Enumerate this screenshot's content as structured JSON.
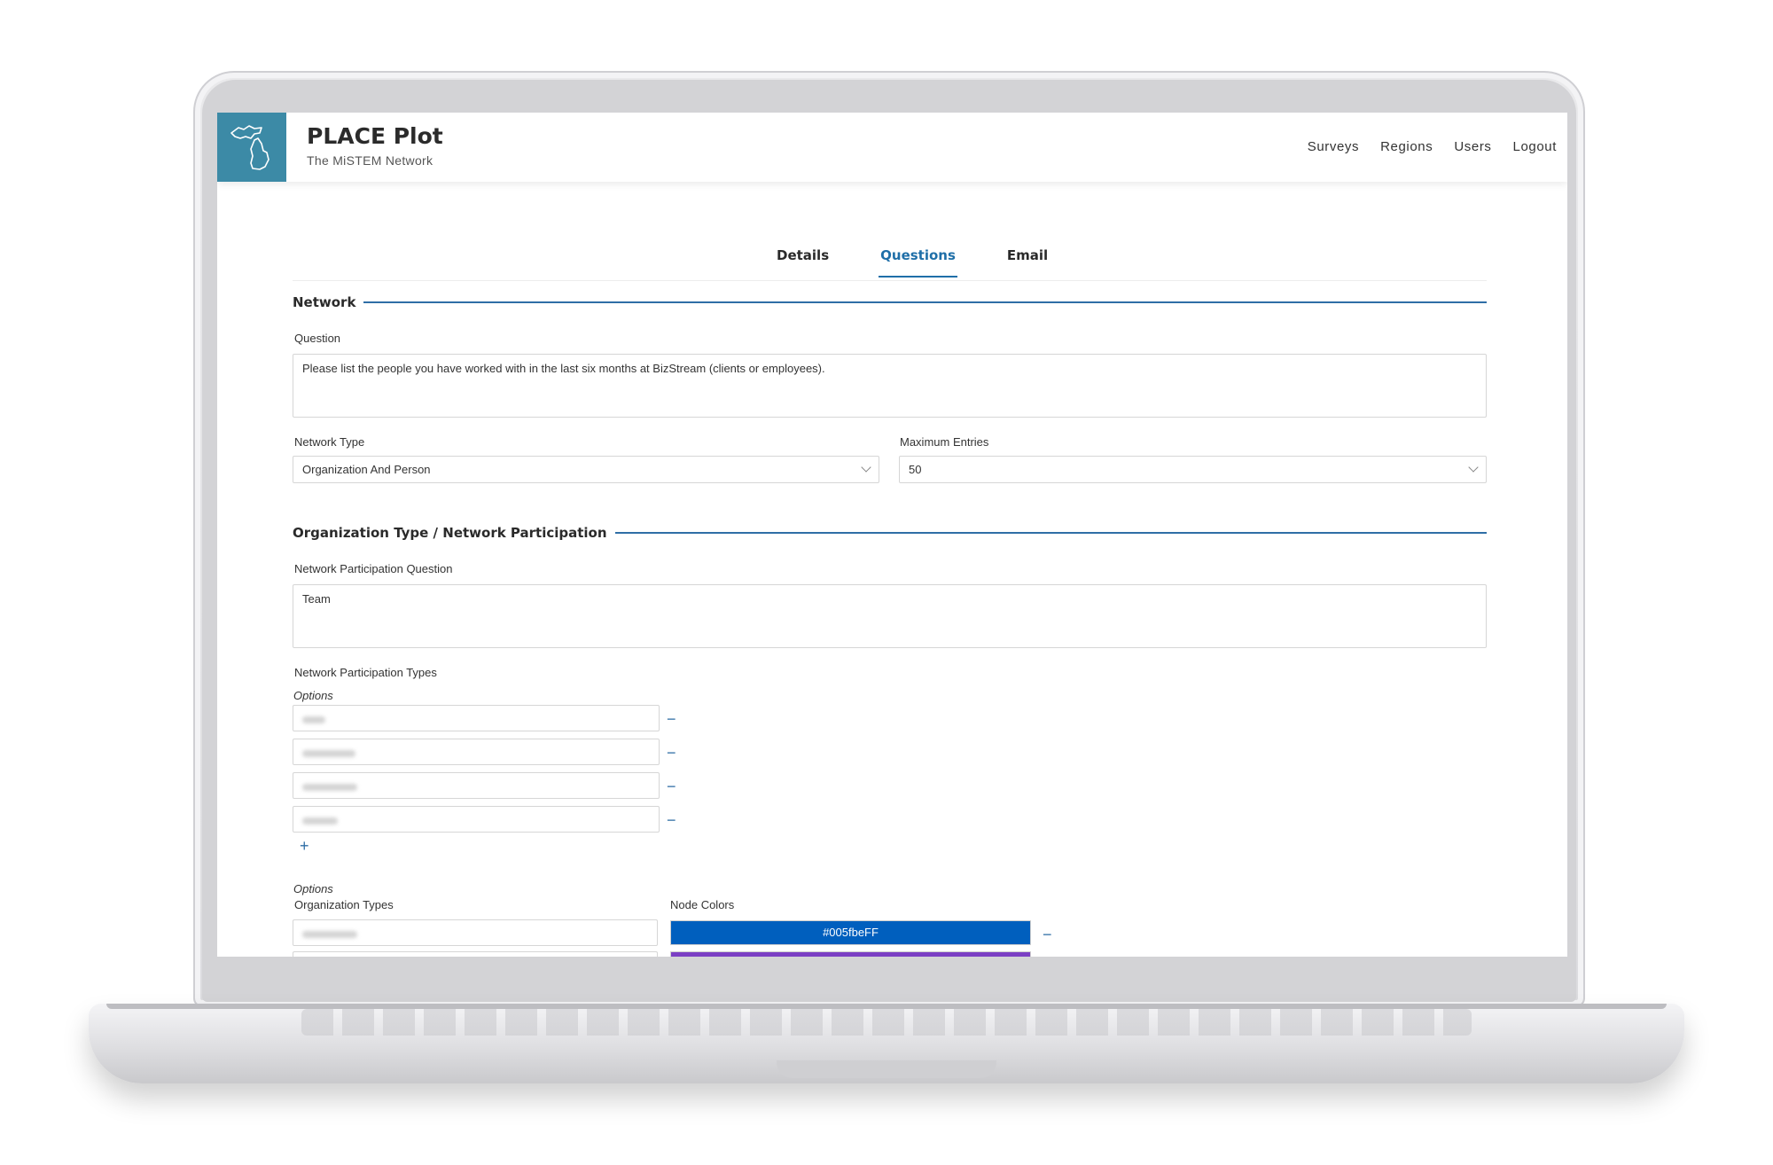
{
  "app": {
    "title": "PLACE Plot",
    "subtitle": "The MiSTEM Network",
    "brand_color": "#3c8aa6"
  },
  "nav": {
    "items": [
      "Surveys",
      "Regions",
      "Users",
      "Logout"
    ]
  },
  "tabs": {
    "items": [
      "Details",
      "Questions",
      "Email"
    ],
    "active": "Questions"
  },
  "network": {
    "section_title": "Network",
    "question_label": "Question",
    "question_value": "Please list the people you have worked with in the last six months at BizStream (clients or employees).",
    "network_type_label": "Network Type",
    "network_type_value": "Organization And Person",
    "max_entries_label": "Maximum Entries",
    "max_entries_value": "50"
  },
  "participation": {
    "section_title": "Organization Type / Network Participation",
    "question_label": "Network Participation Question",
    "question_value": "Team",
    "types_label": "Network Participation Types",
    "options_label": "Options",
    "options_blurred": true
  },
  "org_types": {
    "options_label": "Options",
    "types_label": "Organization Types",
    "colors_label": "Node Colors",
    "first_color_value": "#005fbeFF",
    "first_color_hex": "#005fbe",
    "second_color_hex": "#7b3fc4"
  },
  "accent_color": "#2f6ea6"
}
